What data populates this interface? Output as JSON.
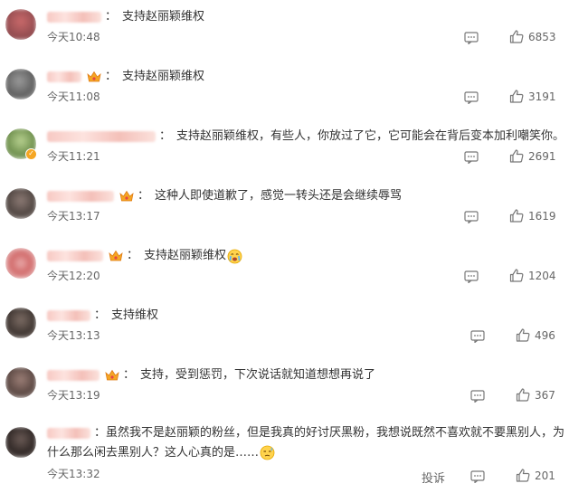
{
  "comments": [
    {
      "text": "支持赵丽颖维权",
      "time": "今天10:48",
      "likes": "6853",
      "crown": false
    },
    {
      "text": "支持赵丽颖维权",
      "time": "今天11:08",
      "likes": "3191",
      "crown": true
    },
    {
      "text": "支持赵丽颖维权，有些人，你放过了它，它可能会在背后变本加利嘲笑你。",
      "time": "今天11:21",
      "likes": "2691",
      "crown": false
    },
    {
      "text": "这种人即使道歉了，感觉一转头还是会继续辱骂",
      "time": "今天13:17",
      "likes": "1619",
      "crown": true
    },
    {
      "text": "支持赵丽颖维权",
      "time": "今天12:20",
      "likes": "1204",
      "crown": true
    },
    {
      "text": "支持维权",
      "time": "今天13:13",
      "likes": "496",
      "crown": false
    },
    {
      "text": "支持，受到惩罚，下次说话就知道想想再说了",
      "time": "今天13:19",
      "likes": "367",
      "crown": true
    },
    {
      "text": "虽然我不是赵丽颖的粉丝，但是我真的好讨厌黑粉，我想说既然不喜欢就不要黑别人，为什么那么闲去黑别人？这人心真的是……",
      "time": "今天13:32",
      "likes": "201",
      "crown": false
    }
  ],
  "separator": "：",
  "report_label": "投诉",
  "colors": {
    "time": "#666666",
    "text": "#333333",
    "crown": "#f5a623"
  },
  "icons": {
    "reply": "comment-icon",
    "like": "thumbs-up-icon",
    "crown": "crown-badge-icon",
    "v": "verified-badge-icon",
    "emoji_cry": "crying-emoji-icon",
    "emoji_sweat": "sweat-emoji-icon"
  }
}
